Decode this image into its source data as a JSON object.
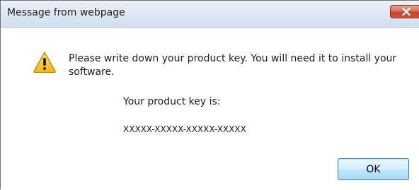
{
  "dialog": {
    "title": "Message from webpage",
    "message": "Please write down your product key. You will need it to install your software.",
    "key_label": "Your product key is:",
    "key_value": "XXXXX-XXXXX-XXXXX-XXXXX",
    "ok_label": "OK",
    "icons": {
      "close": "close-icon",
      "warning": "warning-icon"
    }
  }
}
